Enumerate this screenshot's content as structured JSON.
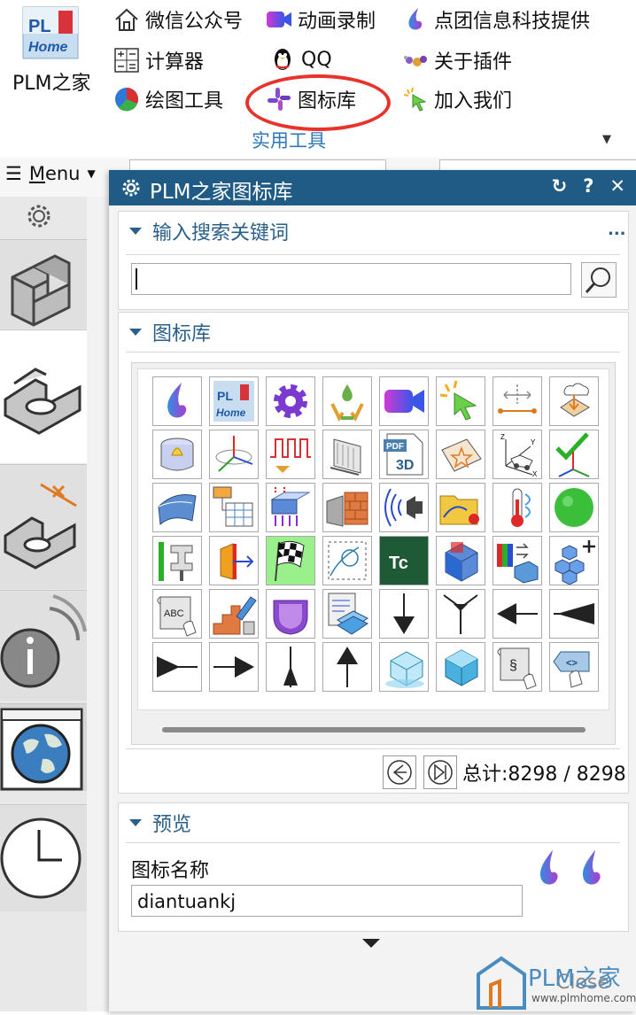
{
  "ribbon": {
    "app_label": "PLM之家",
    "app_logo_text": "PLM Home",
    "group_label": "实用工具",
    "items": [
      {
        "label": "微信公众号",
        "icon": "home-icon"
      },
      {
        "label": "动画录制",
        "icon": "video-camera-icon"
      },
      {
        "label": "点团信息科技提供",
        "icon": "droplet-icon"
      },
      {
        "label": "计算器",
        "icon": "calculator-icon"
      },
      {
        "label": "QQ",
        "icon": "qq-penguin-icon"
      },
      {
        "label": "关于插件",
        "icon": "molecule-icon"
      },
      {
        "label": "绘图工具",
        "icon": "pie-chart-icon"
      },
      {
        "label": "图标库",
        "icon": "slack-icon"
      },
      {
        "label": "加入我们",
        "icon": "sparkle-cursor-icon"
      }
    ]
  },
  "menu": {
    "label_prefix": "M",
    "label_rest": "enu"
  },
  "dialog": {
    "title": "PLM之家图标库",
    "search_section": {
      "title": "输入搜索关键词",
      "more": "...",
      "value": ""
    },
    "library_section": {
      "title": "图标库"
    },
    "icons": [
      "droplet-icon",
      "plm-home-logo-icon",
      "gear-cog-icon",
      "recycle-droplet-icon",
      "video-camera-icon",
      "click-cursor-icon",
      "dimension-line-icon",
      "cloud-upload-icon",
      "cylinder-part-icon",
      "coordinate-axes-icon",
      "pulse-wave-icon",
      "surface-feature-icon",
      "pdf-3d-icon",
      "sketch-star-icon",
      "vehicle-axes-icon",
      "check-axes-icon",
      "curved-surface-icon",
      "table-link-icon",
      "load-arrows-icon",
      "brick-wall-icon",
      "sound-wave-icon",
      "folder-bolt-icon",
      "thermometer-icon",
      "green-ball-icon",
      "clamp-fixture-icon",
      "door-arrow-icon",
      "checkered-flag-icon",
      "sketch-circle-icon",
      "tc-logo-icon",
      "cube-face-icon",
      "books-transfer-icon",
      "cube-stack-add-icon",
      "abc-scroll-icon",
      "stairs-pencil-icon",
      "shell-part-icon",
      "report-layers-icon",
      "arrow-down-line-icon",
      "arrow-down-wedge-icon",
      "arrow-left-line-icon",
      "arrow-left-wedge-icon",
      "arrow-right-wedge-icon",
      "arrow-right-line-icon",
      "arrow-up-wedge-icon",
      "arrow-up-line-icon",
      "cube-light-icon",
      "cube-cyan-icon",
      "scroll-section-icon",
      "code-tag-hand-icon"
    ],
    "pager": {
      "total_label": "总计:8298 / 8298"
    },
    "preview_section": {
      "title": "预览",
      "name_label": "图标名称",
      "name_value": "diantuankj"
    }
  },
  "watermark": {
    "brand": "PLM之家",
    "url": "www.plmhome.com",
    "close_label": "Close"
  }
}
